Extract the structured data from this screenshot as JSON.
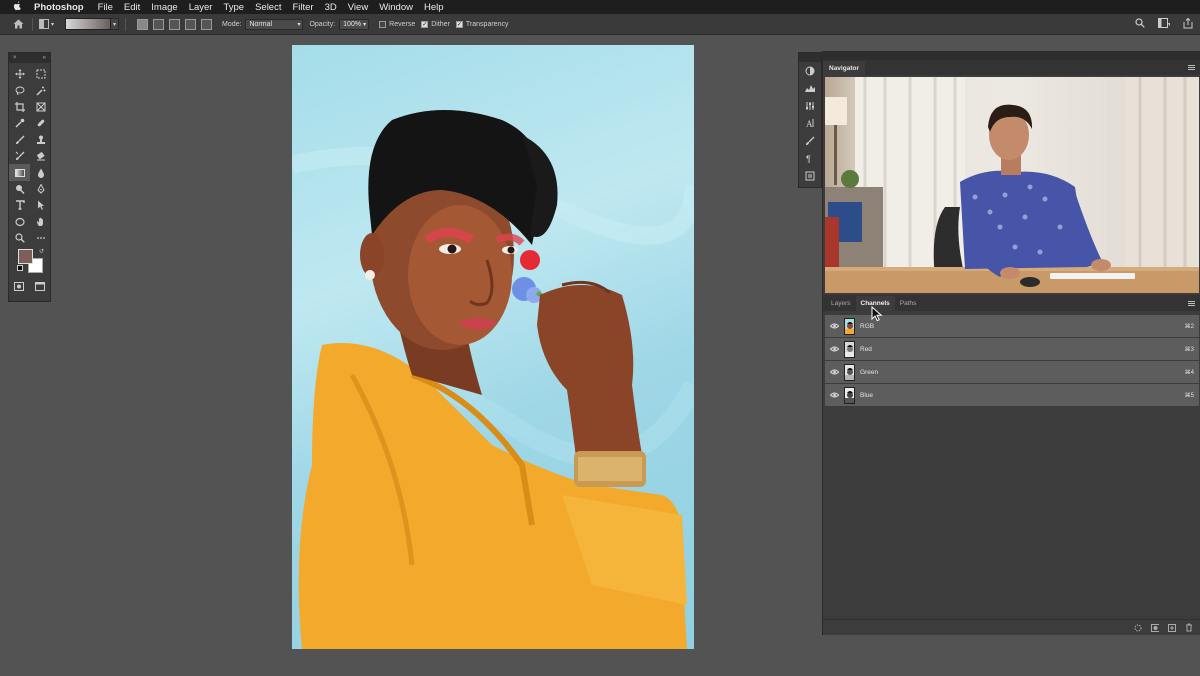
{
  "menubar": {
    "apple_icon": "apple-icon",
    "app_name": "Photoshop",
    "items": [
      "File",
      "Edit",
      "Image",
      "Layer",
      "Type",
      "Select",
      "Filter",
      "3D",
      "View",
      "Window",
      "Help"
    ]
  },
  "options_bar": {
    "mode_label": "Mode:",
    "mode_value": "Normal",
    "opacity_label": "Opacity:",
    "opacity_value": "100%",
    "reverse_label": "Reverse",
    "reverse_checked": false,
    "dither_label": "Dither",
    "dither_checked": true,
    "transparency_label": "Transparency",
    "transparency_checked": true
  },
  "tools": {
    "foreground_color": "#7d5e58",
    "background_color": "#ffffff",
    "active_tool": "gradient-tool"
  },
  "navigator": {
    "tab_label": "Navigator"
  },
  "layers_panel": {
    "tabs": [
      "Layers",
      "Channels",
      "Paths"
    ],
    "active_tab": "Channels",
    "channels": [
      {
        "name": "RGB",
        "shortcut": "⌘2"
      },
      {
        "name": "Red",
        "shortcut": "⌘3"
      },
      {
        "name": "Green",
        "shortcut": "⌘4"
      },
      {
        "name": "Blue",
        "shortcut": "⌘5"
      }
    ]
  }
}
